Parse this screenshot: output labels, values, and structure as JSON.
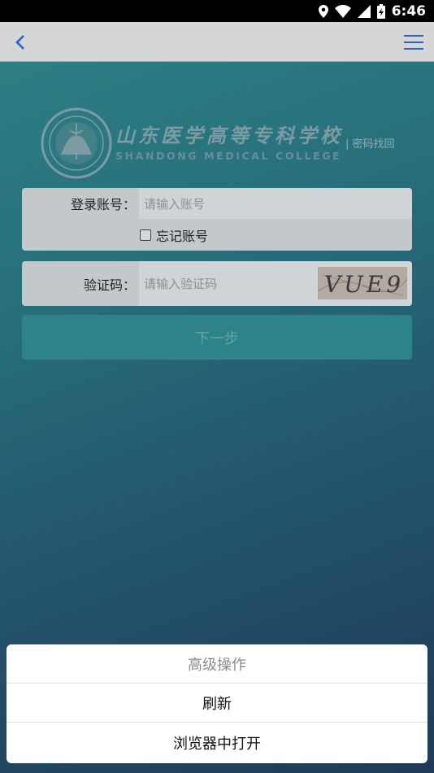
{
  "status_bar": {
    "time": "6:46"
  },
  "app_bar": {
    "back_icon": "chevron-left-icon",
    "menu_icon": "hamburger-menu-icon",
    "accent_color": "#2962c9"
  },
  "header": {
    "school_name_cn": "山东医学高等专科学校",
    "school_name_en": "SHANDONG MEDICAL COLLEGE",
    "recover_link": "| 密码找回"
  },
  "form": {
    "account_label": "登录账号：",
    "account_placeholder": "请输入账号",
    "forget_account_label": "忘记账号",
    "captcha_label": "验证码：",
    "captcha_placeholder": "请输入验证码",
    "captcha_image_text": "VUE9",
    "next_button": "下一步"
  },
  "action_sheet": {
    "title": "高级操作",
    "items": [
      "刷新",
      "浏览器中打开"
    ]
  }
}
